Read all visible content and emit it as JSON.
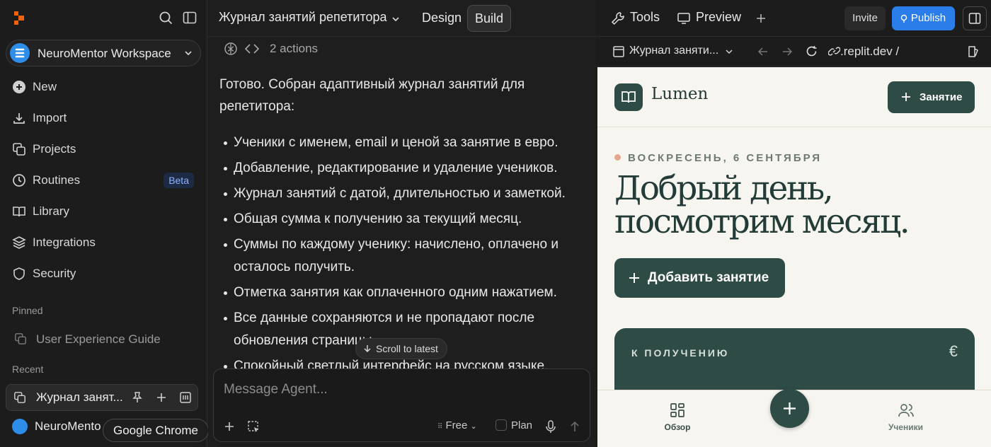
{
  "sidebar": {
    "workspace_name": "NeuroMentor Workspace",
    "items": [
      {
        "label": "New",
        "icon": "plus-circle-icon"
      },
      {
        "label": "Import",
        "icon": "download-icon"
      },
      {
        "label": "Projects",
        "icon": "projects-icon"
      },
      {
        "label": "Routines",
        "icon": "clock-icon",
        "badge": "Beta"
      },
      {
        "label": "Library",
        "icon": "book-icon"
      },
      {
        "label": "Integrations",
        "icon": "layers-icon"
      },
      {
        "label": "Security",
        "icon": "shield-icon"
      }
    ],
    "pinned_label": "Pinned",
    "pinned_item": "User Experience Guide",
    "recent_label": "Recent",
    "recent_item": "Журнал занят...",
    "workspace_item": "NeuroMento",
    "tooltip": "Google Chrome"
  },
  "chat": {
    "project_title": "Журнал занятий репетитора",
    "tabs": {
      "design": "Design",
      "build": "Build"
    },
    "actions": "2 actions",
    "intro": "Готово. Собран адаптивный журнал занятий для репетитора:",
    "bullets": [
      "Ученики с именем, email и ценой за занятие в евро.",
      "Добавление, редактирование и удаление учеников.",
      "Журнал занятий с датой, длительностью и заметкой.",
      "Общая сумма к получению за текущий месяц.",
      "Суммы по каждому ученику: начислено, оплачено и осталось получить.",
      "Отметка занятия как оплаченного одним нажатием.",
      "Все данные сохраняются и не пропадают после обновления страницы.",
      "Спокойный светлый интерфейс на русском языке."
    ],
    "scroll_latest": "Scroll to latest",
    "composer": {
      "placeholder": "Message Agent...",
      "mode": "Free",
      "plan": "Plan"
    }
  },
  "right": {
    "tabs": {
      "tools": "Tools",
      "preview": "Preview"
    },
    "invite": "Invite",
    "publish": "Publish",
    "page_title": "Журнал заняти...",
    "url": ".replit.dev /"
  },
  "preview": {
    "brand": "Lumen",
    "header_button": "Занятие",
    "date": "ВОСКРЕСЕНЬ, 6 СЕНТЯБРЯ",
    "greeting_line1": "Добрый день,",
    "greeting_line2": "посмотрим месяц.",
    "add_button": "Добавить занятие",
    "card_label": "К ПОЛУЧЕНИЮ",
    "card_currency": "€",
    "nav": {
      "overview": "Обзор",
      "students": "Ученики"
    }
  },
  "colors": {
    "accent": "#2f4b46",
    "publish": "#2b7de9",
    "preview_bg": "#f7f5f0"
  }
}
